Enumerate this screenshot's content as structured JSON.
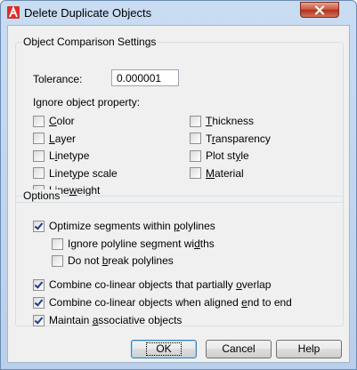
{
  "window": {
    "title": "Delete Duplicate Objects"
  },
  "comparison": {
    "legend": "Object Comparison Settings",
    "tolerance_label": "Tolerance:",
    "tolerance_value": "0.000001",
    "ignore_label": "Ignore object property:",
    "properties_left": [
      {
        "pre": "",
        "u": "C",
        "post": "olor",
        "checked": false
      },
      {
        "pre": "",
        "u": "L",
        "post": "ayer",
        "checked": false
      },
      {
        "pre": "L",
        "u": "i",
        "post": "netype",
        "checked": false
      },
      {
        "pre": "Linet",
        "u": "y",
        "post": "pe scale",
        "checked": false
      },
      {
        "pre": "Line",
        "u": "w",
        "post": "eight",
        "checked": false
      }
    ],
    "properties_right": [
      {
        "pre": "",
        "u": "T",
        "post": "hickness",
        "checked": false
      },
      {
        "pre": "T",
        "u": "r",
        "post": "ansparency",
        "checked": false
      },
      {
        "pre": "Plot st",
        "u": "y",
        "post": "le",
        "checked": false
      },
      {
        "pre": "",
        "u": "M",
        "post": "aterial",
        "checked": false
      }
    ]
  },
  "options": {
    "legend": "Options",
    "items": [
      {
        "pre": "Optimize segments within ",
        "u": "p",
        "post": "olylines",
        "checked": true
      },
      {
        "pre": "Ignore polyline segment wi",
        "u": "d",
        "post": "ths",
        "checked": false
      },
      {
        "pre": "Do not ",
        "u": "b",
        "post": "reak polylines",
        "checked": false
      },
      {
        "pre": "Combine co-linear objects that partially ",
        "u": "o",
        "post": "verlap",
        "checked": true
      },
      {
        "pre": "Combine co-linear objects when aligned ",
        "u": "e",
        "post": "nd to end",
        "checked": true
      },
      {
        "pre": "Maintain ",
        "u": "a",
        "post": "ssociative objects",
        "checked": true
      }
    ]
  },
  "buttons": {
    "ok": "OK",
    "cancel": "Cancel",
    "help": "Help"
  }
}
